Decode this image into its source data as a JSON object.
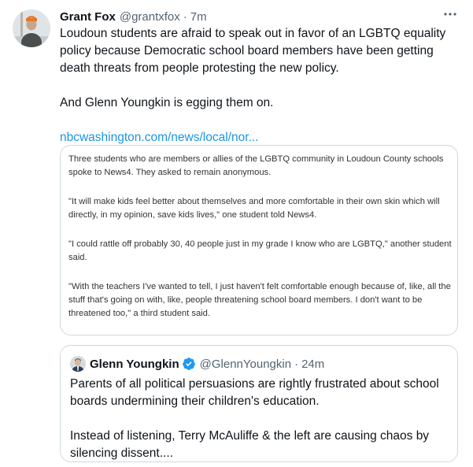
{
  "tweet": {
    "display_name": "Grant Fox",
    "handle": "@grantxfox",
    "separator": "·",
    "timestamp": "7m",
    "avatar_icon": "person-avatar-icon",
    "more_icon": "more-horizontal-icon",
    "text_paragraph_1": "Loudoun students are afraid to speak out in favor of an LGBTQ equality policy because Democratic school board members have been getting death threats from people protesting the new policy.",
    "text_paragraph_2": "And Glenn Youngkin is egging them on.",
    "link_text": "nbcwashington.com/news/local/nor...",
    "link_color": "#1b95e0"
  },
  "link_card": {
    "paragraphs": [
      "Three students who are members or allies of the LGBTQ community in Loudoun County schools spoke to News4. They asked to remain anonymous.",
      "\"It will make kids feel better about themselves and more comfortable in their own skin which will directly, in my opinion, save kids lives,\" one student told News4.",
      "\"I could rattle off probably 30, 40 people just in my grade I know who are LGBTQ,\" another student said.",
      "\"With the teachers I've wanted to tell, I just haven't felt comfortable enough because of, like, all the stuff that's going on with, like, people threatening school board members. I don't want to be threatened too,\" a third student said."
    ]
  },
  "quoted_tweet": {
    "display_name": "Glenn Youngkin",
    "verified_icon": "verified-badge-icon",
    "verified_color": "#1d9bf0",
    "handle": "@GlennYoungkin",
    "separator": "·",
    "timestamp": "24m",
    "text_paragraph_1": "Parents of all political persuasions are rightly frustrated about school boards undermining their children's education.",
    "text_paragraph_2": "Instead of listening, Terry McAuliffe & the left are causing chaos by silencing dissent...."
  }
}
